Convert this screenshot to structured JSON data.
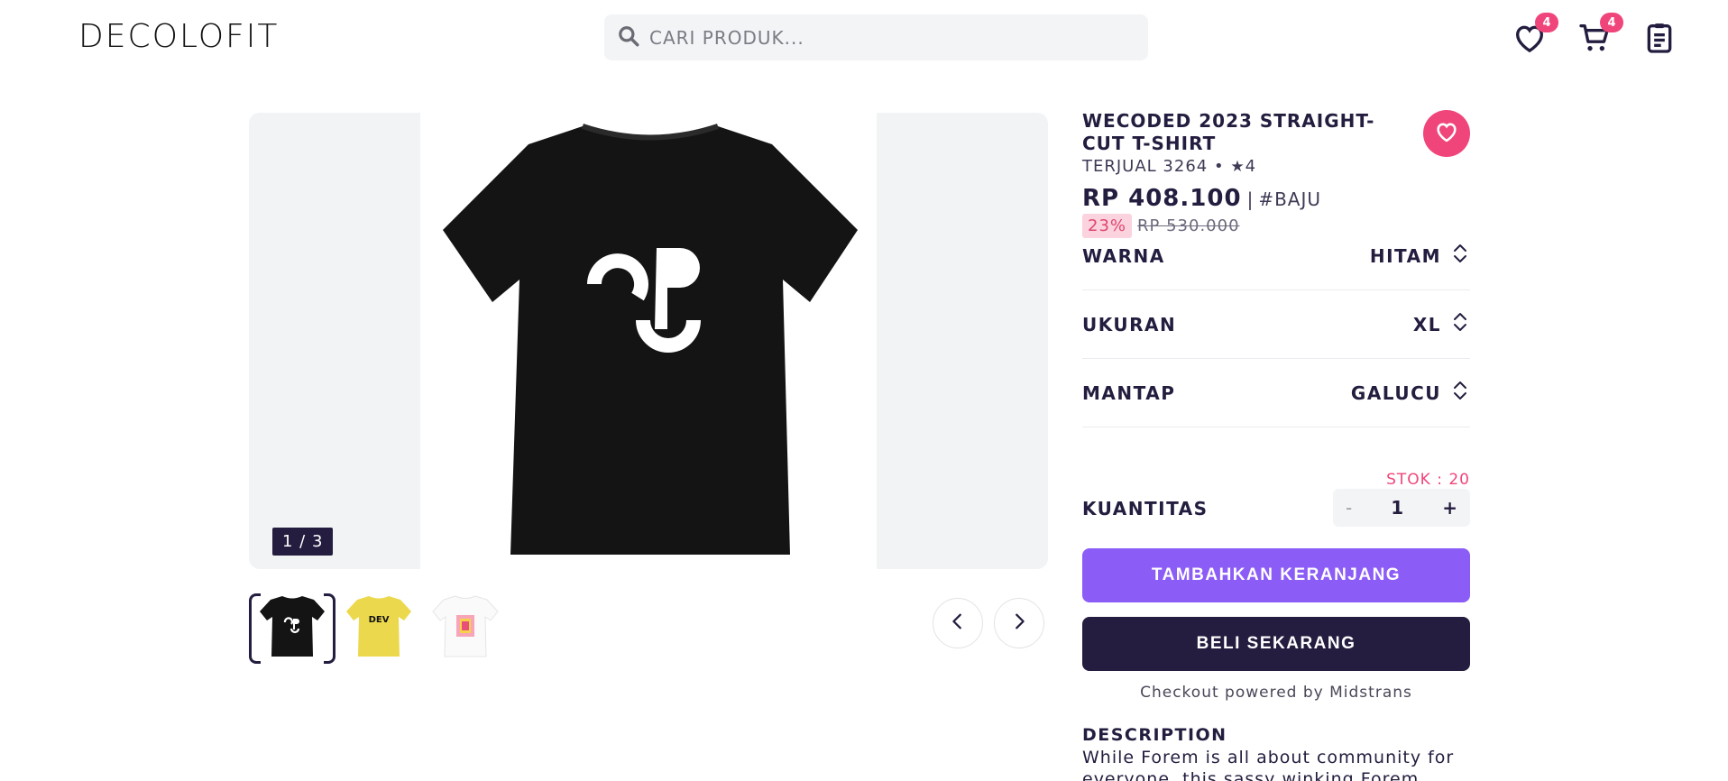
{
  "header": {
    "logo": "DECOLOFIT",
    "search_placeholder": "CARI PRODUK...",
    "wishlist_count": "4",
    "cart_count": "4"
  },
  "gallery": {
    "counter": "1 / 3",
    "thumbnails": [
      {
        "label": "black-tshirt",
        "selected": true
      },
      {
        "label": "DEV",
        "selected": false
      },
      {
        "label": "white-tshirt",
        "selected": false
      }
    ]
  },
  "product": {
    "title": "WECODED 2023 STRAIGHT-CUT T-SHIRT",
    "sold": "TERJUAL 3264 •",
    "rating": "4",
    "price": "RP 408.100",
    "separator": "|",
    "category": "#BAJU",
    "discount": "23%",
    "old_price": "RP 530.000"
  },
  "options": [
    {
      "label": "WARNA",
      "value": "HITAM"
    },
    {
      "label": "UKURAN",
      "value": "XL"
    },
    {
      "label": "MANTAP",
      "value": "GALUCU"
    }
  ],
  "quantity": {
    "stock": "STOK : 20",
    "label": "KUANTITAS",
    "minus": "-",
    "value": "1",
    "plus": "+"
  },
  "actions": {
    "add_to_cart": "TAMBAHKAN KERANJANG",
    "buy_now": "BELI SEKARANG",
    "powered_by": "Checkout powered by Midstrans"
  },
  "description": {
    "heading": "DESCRIPTION",
    "text": "While Forem is all about community for everyone, this sassy winking Forem"
  },
  "colors": {
    "primary_dark": "#241d3f",
    "accent_purple": "#8b5cf6",
    "accent_pink": "#f0457a"
  }
}
